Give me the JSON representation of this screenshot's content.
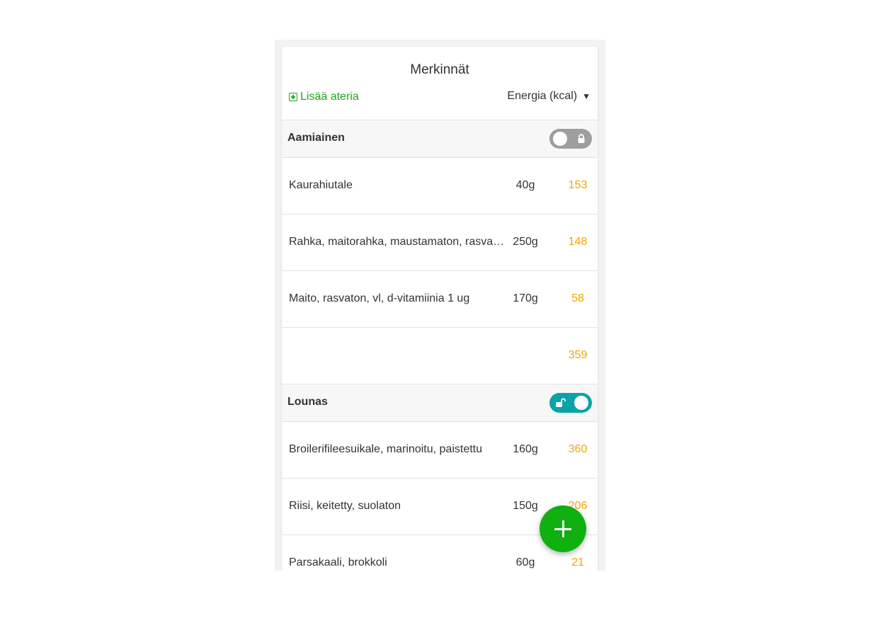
{
  "header": {
    "title": "Merkinnät",
    "add_meal_label": "Lisää ateria",
    "energy_unit_label": "Energia (kcal)"
  },
  "meals": [
    {
      "name": "Aamiainen",
      "locked": true,
      "items": [
        {
          "food": "Kaurahiutale",
          "amount": "40g",
          "kcal": "153"
        },
        {
          "food": "Rahka, maitorahka, maustamaton, rasvaton",
          "amount": "250g",
          "kcal": "148"
        },
        {
          "food": "Maito, rasvaton, vl, d-vitamiinia 1 ug",
          "amount": "170g",
          "kcal": "58"
        }
      ],
      "total_kcal": "359"
    },
    {
      "name": "Lounas",
      "locked": false,
      "items": [
        {
          "food": "Broilerifileesuikale, marinoitu, paistettu",
          "amount": "160g",
          "kcal": "360"
        },
        {
          "food": "Riisi, keitetty, suolaton",
          "amount": "150g",
          "kcal": "206"
        },
        {
          "food": "Parsakaali, brokkoli",
          "amount": "60g",
          "kcal": "21"
        }
      ]
    }
  ],
  "colors": {
    "accent_green": "#21a321",
    "kcal_orange": "#f5a500",
    "toggle_on": "#0aa3a7",
    "toggle_off": "#9e9e9e"
  },
  "icons": [
    "plus-square-icon",
    "caret-down-icon",
    "lock-icon",
    "unlock-icon",
    "plus-icon"
  ]
}
